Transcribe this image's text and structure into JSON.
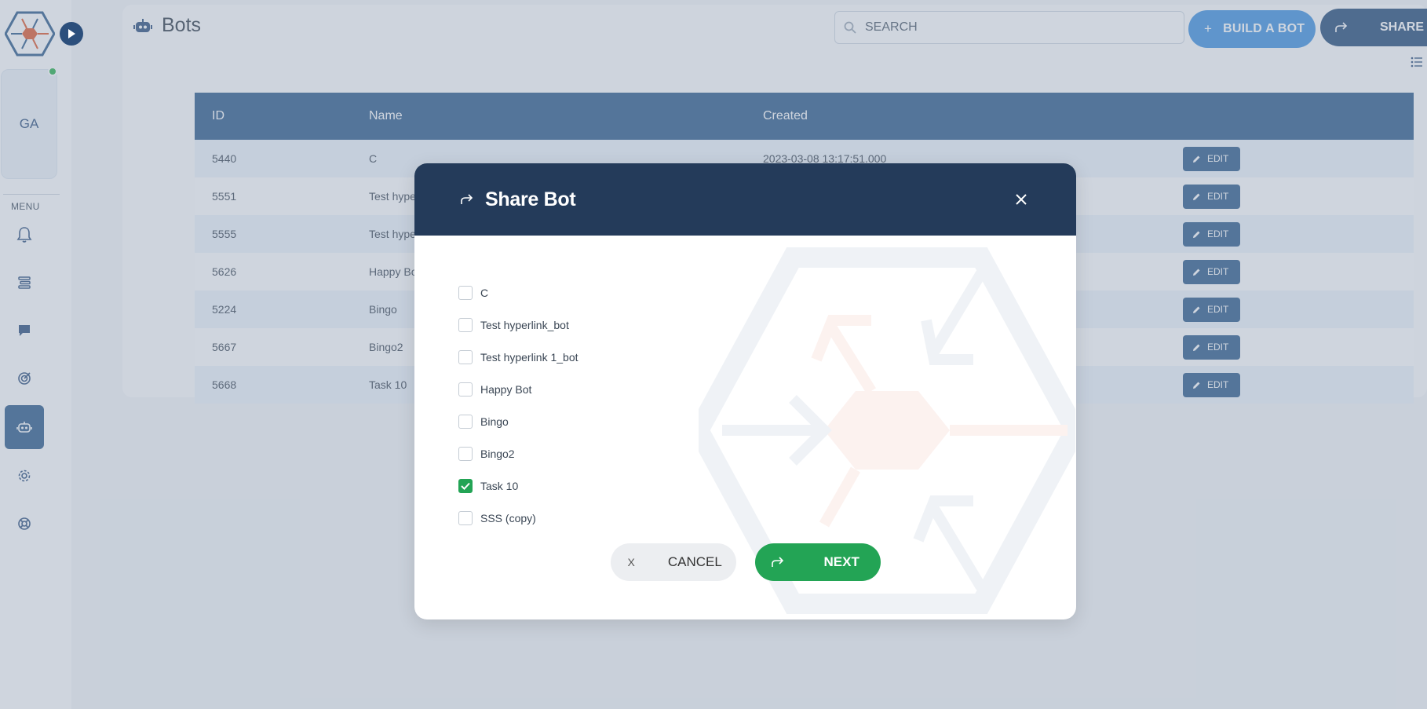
{
  "sidebar": {
    "user_initials": "GA",
    "menu_label": "MENU",
    "items": [
      {
        "icon": "bell-icon"
      },
      {
        "icon": "list-icon"
      },
      {
        "icon": "chat-icon"
      },
      {
        "icon": "target-icon"
      },
      {
        "icon": "robot-icon",
        "active": true
      },
      {
        "icon": "gear-icon"
      },
      {
        "icon": "lifebuoy-icon"
      }
    ]
  },
  "header": {
    "title": "Bots",
    "search_placeholder": "SEARCH",
    "build_button": "BUILD A BOT",
    "build_button_icon": "+",
    "share_button": "SHARE"
  },
  "table": {
    "columns": [
      "ID",
      "Name",
      "Created"
    ],
    "rows": [
      {
        "id": "5440",
        "name": "C",
        "created": "2023-03-08 13:17:51.000",
        "action": "EDIT"
      },
      {
        "id": "5551",
        "name": "Test hype",
        "created": "",
        "action": "EDIT"
      },
      {
        "id": "5555",
        "name": "Test hype",
        "created": "",
        "action": "EDIT"
      },
      {
        "id": "5626",
        "name": "Happy Bo",
        "created": "",
        "action": "EDIT"
      },
      {
        "id": "5224",
        "name": "Bingo",
        "created": "",
        "action": "EDIT"
      },
      {
        "id": "5667",
        "name": "Bingo2",
        "created": "",
        "action": "EDIT"
      },
      {
        "id": "5668",
        "name": "Task 10",
        "created": "",
        "action": "EDIT"
      }
    ]
  },
  "modal": {
    "title": "Share Bot",
    "options": [
      {
        "label": "C",
        "checked": false
      },
      {
        "label": "Test hyperlink_bot",
        "checked": false
      },
      {
        "label": "Test hyperlink 1_bot",
        "checked": false
      },
      {
        "label": "Happy Bot",
        "checked": false
      },
      {
        "label": "Bingo",
        "checked": false
      },
      {
        "label": "Bingo2",
        "checked": false
      },
      {
        "label": "Task 10",
        "checked": true
      },
      {
        "label": "SSS (copy)",
        "checked": false
      }
    ],
    "cancel_icon": "X",
    "cancel_label": "CANCEL",
    "next_label": "NEXT"
  },
  "colors": {
    "primary": "#2c5a8a",
    "header_dark": "#243b5a",
    "accent_blue": "#3e92e0",
    "success": "#23a455"
  }
}
